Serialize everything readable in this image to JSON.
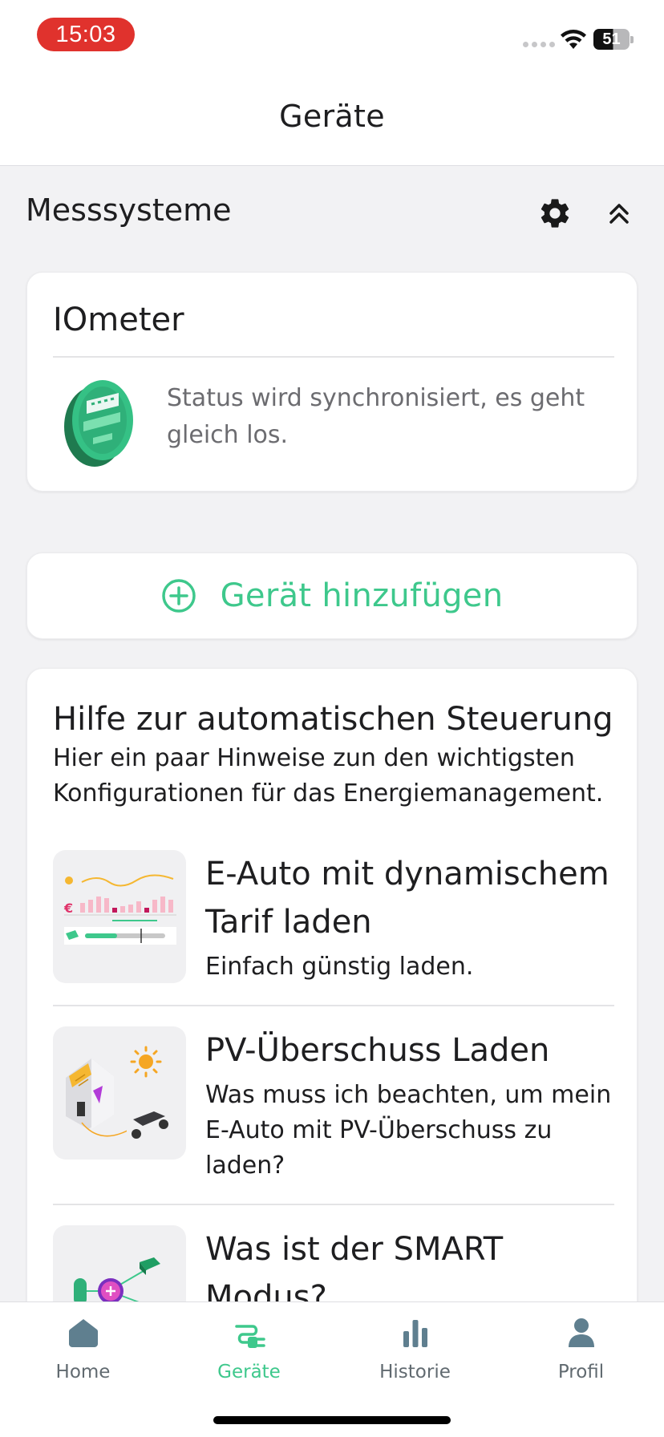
{
  "status_bar": {
    "time": "15:03",
    "battery": "51"
  },
  "header": {
    "title": "Geräte"
  },
  "section": {
    "title": "Messsysteme",
    "icons": [
      "gear-icon",
      "chevron-double-up-icon"
    ]
  },
  "device": {
    "name": "IOmeter",
    "status": "Status wird synchronisiert, es geht gleich los."
  },
  "add_device": {
    "label": "Gerät hinzufügen"
  },
  "help": {
    "title": "Hilfe zur automatischen Steuerung",
    "subtitle": "Hier ein paar Hinweise zun den wichtigsten Konfigurationen für das Energiemanagement.",
    "items": [
      {
        "title": "E-Auto mit dynamischem Tarif laden",
        "description": "Einfach günstig laden."
      },
      {
        "title": "PV-Überschuss Laden",
        "description": "Was muss ich beachten, um mein E-Auto mit PV-Überschuss zu laden?"
      },
      {
        "title": "Was ist der SMART Modus?",
        "description": ""
      }
    ]
  },
  "tabs": [
    {
      "label": "Home",
      "icon": "home-icon",
      "active": false
    },
    {
      "label": "Geräte",
      "icon": "plug-icon",
      "active": true
    },
    {
      "label": "Historie",
      "icon": "bar-chart-icon",
      "active": false
    },
    {
      "label": "Profil",
      "icon": "person-icon",
      "active": false
    }
  ],
  "colors": {
    "accent": "#3ec88c",
    "time_pill": "#e0322d",
    "background": "#f2f2f4",
    "tab_inactive": "#616a70"
  }
}
